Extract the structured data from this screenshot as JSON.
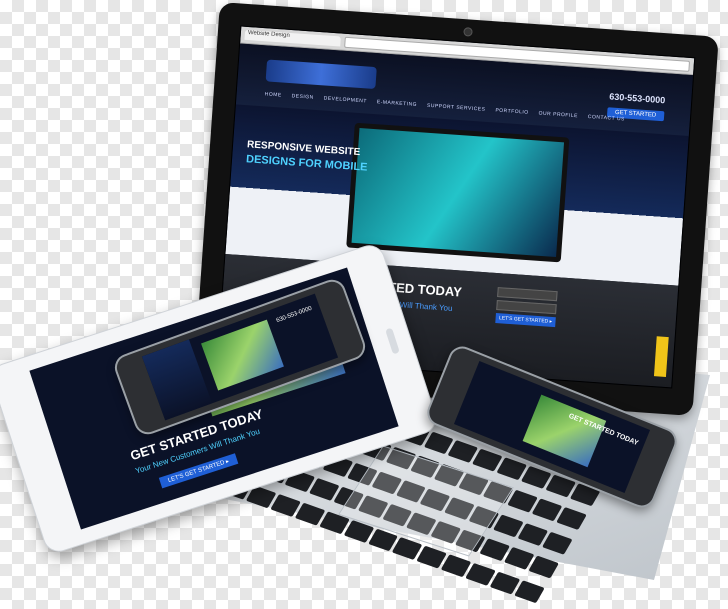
{
  "laptop": {
    "browser_tab": "Website Design",
    "phone": "630-553-0000",
    "cta": "GET STARTED",
    "nav": [
      "HOME",
      "DESIGN",
      "DEVELOPMENT",
      "E-MARKETING",
      "SUPPORT SERVICES",
      "PORTFOLIO",
      "OUR PROFILE",
      "CONTACT US"
    ],
    "hero_line1": "RESPONSIVE WEBSITE",
    "hero_line2": "DESIGNS FOR MOBILE",
    "band_title": "GET STARTED TODAY",
    "band_subtitle": "Your New Customers Will Thank You",
    "band_button": "LET'S GET STARTED ▸"
  },
  "tablet": {
    "title": "GET STARTED TODAY",
    "subtitle": "Your New Customers Will Thank You",
    "button": "LET'S GET STARTED ▸"
  },
  "phone_1": {
    "phone": "630-553-0000"
  },
  "phone_2": {
    "title": "GET STARTED TODAY"
  }
}
